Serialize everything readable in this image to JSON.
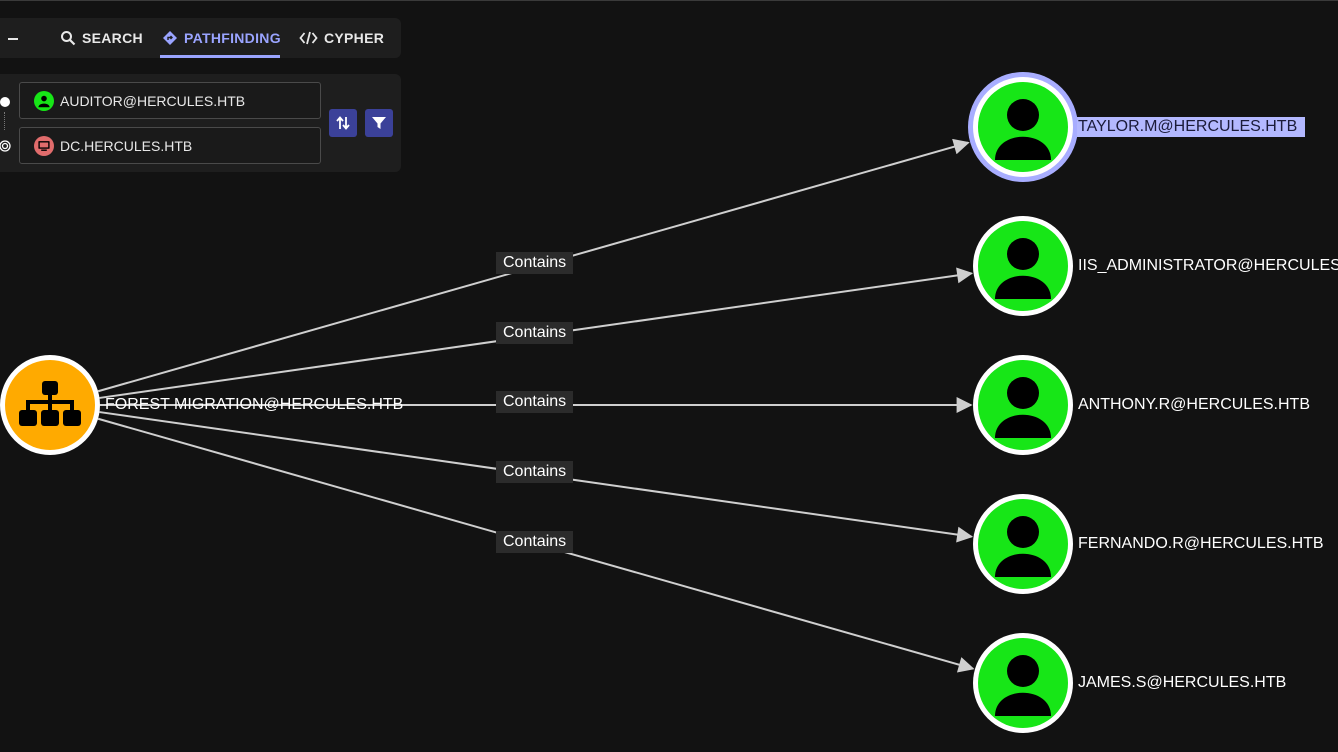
{
  "tabs": {
    "search": "SEARCH",
    "pathfinding": "PATHFINDING",
    "cypher": "CYPHER"
  },
  "pathfinding": {
    "start_node": "AUDITOR@HERCULES.HTB",
    "end_node": "DC.HERCULES.HTB"
  },
  "graph": {
    "source": {
      "label": "FOREST MIGRATION@HERCULES.HTB",
      "type": "OU",
      "color": "#ffaa00",
      "icon": "sitemap-icon"
    },
    "edge_label": "Contains",
    "targets": [
      {
        "label": "TAYLOR.M@HERCULES.HTB",
        "type": "User",
        "selected": true
      },
      {
        "label": "IIS_ADMINISTRATOR@HERCULES.",
        "type": "User"
      },
      {
        "label": "ANTHONY.R@HERCULES.HTB",
        "type": "User"
      },
      {
        "label": "FERNANDO.R@HERCULES.HTB",
        "type": "User"
      },
      {
        "label": "JAMES.S@HERCULES.HTB",
        "type": "User"
      }
    ],
    "edges": [
      {
        "label": "Contains"
      },
      {
        "label": "Contains"
      },
      {
        "label": "Contains"
      },
      {
        "label": "Contains"
      },
      {
        "label": "Contains"
      }
    ]
  },
  "colors": {
    "user_node": "#17e617",
    "ou_node": "#ffaa00",
    "accent": "#9aa4ff",
    "selected_ring": "#a8adff",
    "computer_badge": "#e16c6c"
  }
}
